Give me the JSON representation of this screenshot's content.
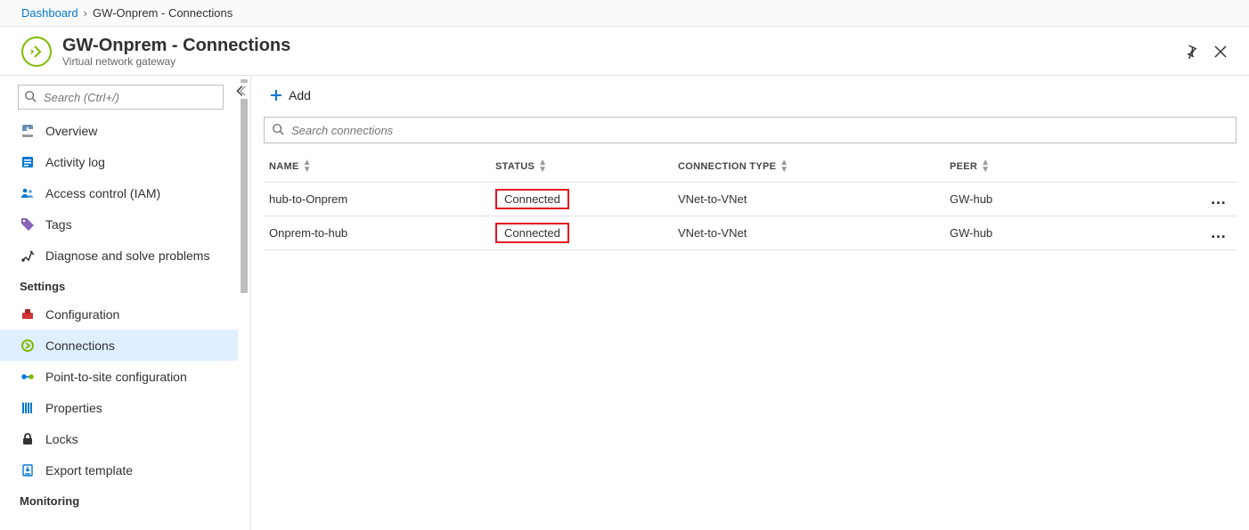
{
  "breadcrumb": {
    "root": "Dashboard",
    "current": "GW-Onprem - Connections"
  },
  "header": {
    "title": "GW-Onprem - Connections",
    "subtitle": "Virtual network gateway"
  },
  "sidebar": {
    "search_placeholder": "Search (Ctrl+/)",
    "groups": [
      {
        "label": null,
        "items": [
          {
            "key": "overview",
            "label": "Overview"
          },
          {
            "key": "activity-log",
            "label": "Activity log"
          },
          {
            "key": "access-control",
            "label": "Access control (IAM)"
          },
          {
            "key": "tags",
            "label": "Tags"
          },
          {
            "key": "diagnose",
            "label": "Diagnose and solve problems"
          }
        ]
      },
      {
        "label": "Settings",
        "items": [
          {
            "key": "configuration",
            "label": "Configuration"
          },
          {
            "key": "connections",
            "label": "Connections",
            "active": true
          },
          {
            "key": "p2s",
            "label": "Point-to-site configuration"
          },
          {
            "key": "properties",
            "label": "Properties"
          },
          {
            "key": "locks",
            "label": "Locks"
          },
          {
            "key": "export",
            "label": "Export template"
          }
        ]
      },
      {
        "label": "Monitoring",
        "items": []
      }
    ]
  },
  "toolbar": {
    "add_label": "Add"
  },
  "table": {
    "filter_placeholder": "Search connections",
    "columns": {
      "name": "NAME",
      "status": "STATUS",
      "type": "CONNECTION TYPE",
      "peer": "PEER"
    },
    "rows": [
      {
        "name": "hub-to-Onprem",
        "status": "Connected",
        "type": "VNet-to-VNet",
        "peer": "GW-hub"
      },
      {
        "name": "Onprem-to-hub",
        "status": "Connected",
        "type": "VNet-to-VNet",
        "peer": "GW-hub"
      }
    ]
  }
}
